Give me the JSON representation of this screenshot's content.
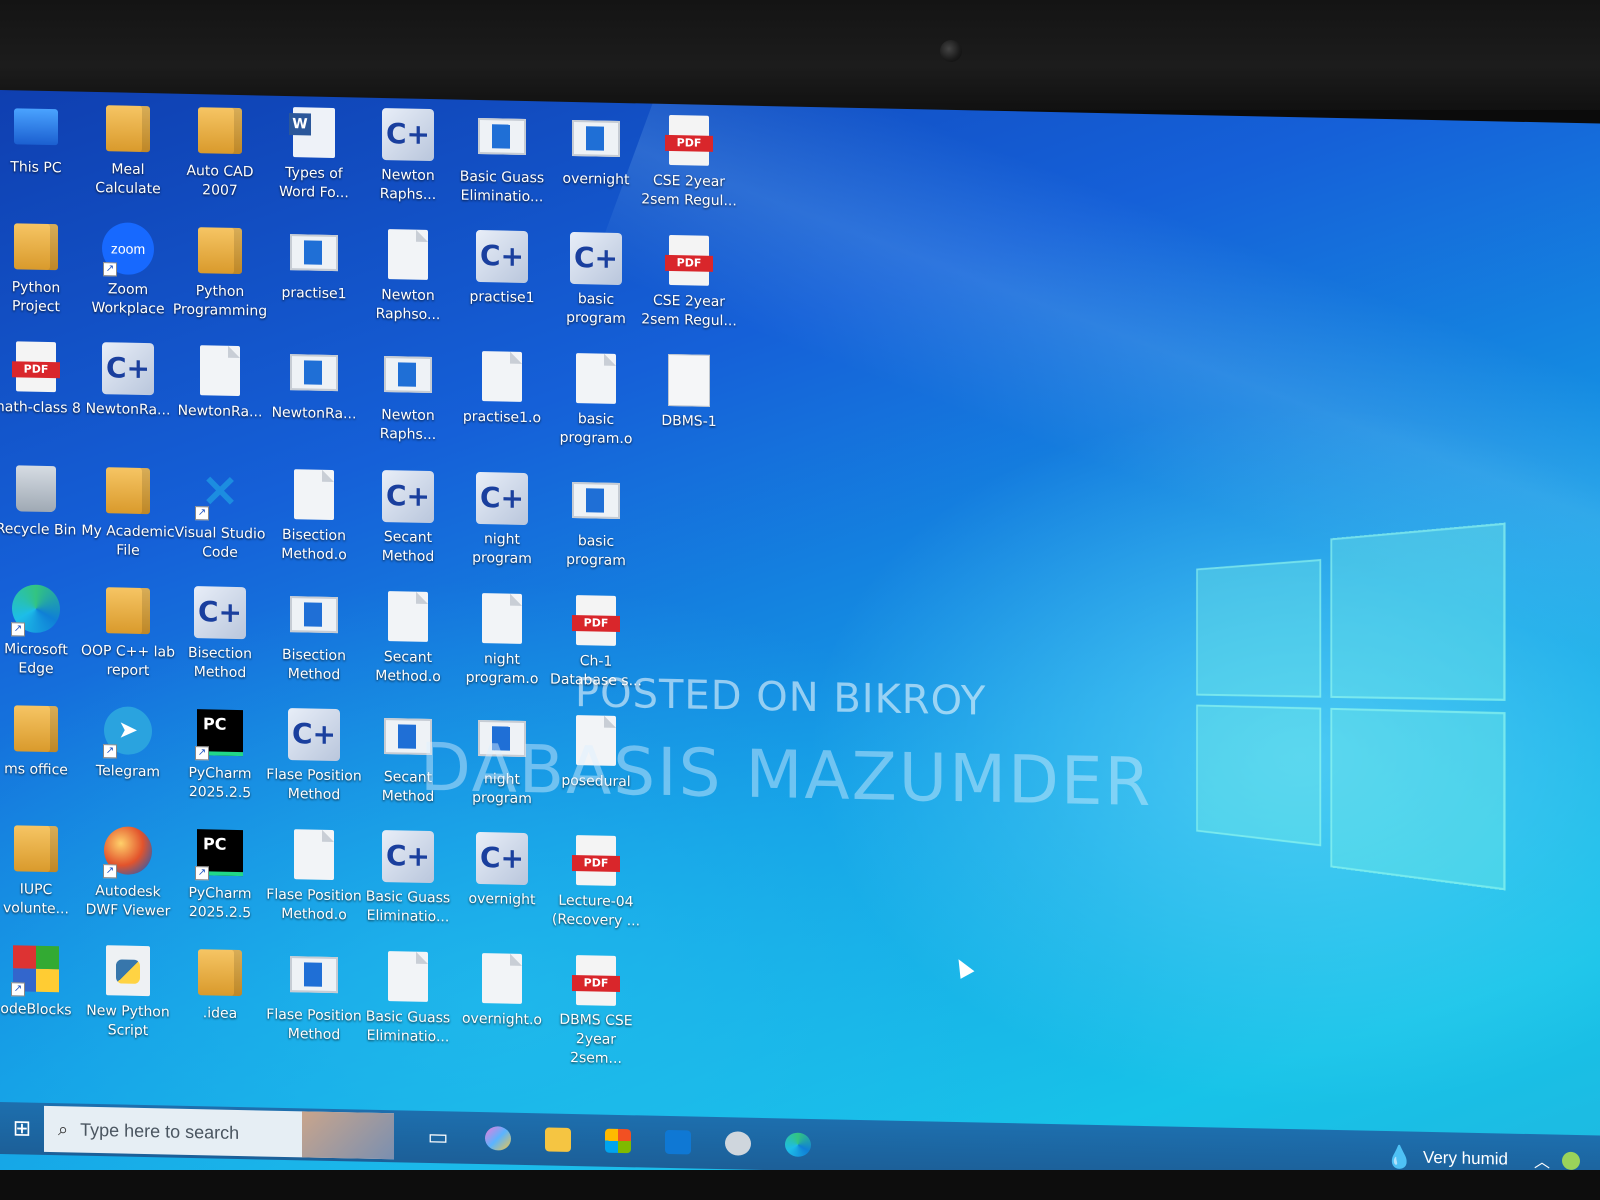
{
  "watermark": {
    "line1": "POSTED ON BIKROY",
    "line2": "DABASIS MAZUMDER"
  },
  "desktop_icons": [
    {
      "label": "This PC",
      "icon": "pc-icon"
    },
    {
      "label": "Meal Calculate",
      "icon": "folder-icon"
    },
    {
      "label": "Auto CAD 2007",
      "icon": "folder-icon"
    },
    {
      "label": "Types of Word Fo...",
      "icon": "word-doc-icon"
    },
    {
      "label": "Newton Raphs...",
      "icon": "cpp-file-icon"
    },
    {
      "label": "Basic Guass Eliminatio...",
      "icon": "exe-icon"
    },
    {
      "label": "overnight",
      "icon": "exe-icon"
    },
    {
      "label": "CSE 2year 2sem Regul...",
      "icon": "pdf-icon"
    },
    {
      "label": "Python Project",
      "icon": "folder-icon"
    },
    {
      "label": "Zoom Workplace",
      "icon": "zoom-icon"
    },
    {
      "label": "Python Programming",
      "icon": "folder-icon"
    },
    {
      "label": "practise1",
      "icon": "exe-icon"
    },
    {
      "label": "Newton Raphso...",
      "icon": "file-icon"
    },
    {
      "label": "practise1",
      "icon": "cpp-file-icon"
    },
    {
      "label": "basic program",
      "icon": "cpp-file-icon"
    },
    {
      "label": "CSE 2year 2sem Regul...",
      "icon": "pdf-icon"
    },
    {
      "label": "math-class 8",
      "icon": "pdf-icon"
    },
    {
      "label": "NewtonRa...",
      "icon": "cpp-file-icon"
    },
    {
      "label": "NewtonRa...",
      "icon": "file-icon"
    },
    {
      "label": "NewtonRa...",
      "icon": "exe-icon"
    },
    {
      "label": "Newton Raphs...",
      "icon": "exe-icon"
    },
    {
      "label": "practise1.o",
      "icon": "file-icon"
    },
    {
      "label": "basic program.o",
      "icon": "file-icon"
    },
    {
      "label": "DBMS-1",
      "icon": "dbms-doc-icon"
    },
    {
      "label": "Recycle Bin",
      "icon": "recycle-bin-icon"
    },
    {
      "label": "My Academic File",
      "icon": "folder-icon"
    },
    {
      "label": "Visual Studio Code",
      "icon": "vscode-icon"
    },
    {
      "label": "Bisection Method.o",
      "icon": "file-icon"
    },
    {
      "label": "Secant Method",
      "icon": "cpp-file-icon"
    },
    {
      "label": "night program",
      "icon": "cpp-file-icon"
    },
    {
      "label": "basic program",
      "icon": "exe-icon"
    },
    {
      "label": "Microsoft Edge",
      "icon": "edge-icon"
    },
    {
      "label": "OOP C++ lab report",
      "icon": "folder-icon"
    },
    {
      "label": "Bisection Method",
      "icon": "cpp-file-icon"
    },
    {
      "label": "Bisection Method",
      "icon": "exe-icon"
    },
    {
      "label": "Secant Method.o",
      "icon": "file-icon"
    },
    {
      "label": "night program.o",
      "icon": "file-icon"
    },
    {
      "label": "Ch-1 Database s...",
      "icon": "pdf-icon"
    },
    {
      "label": "ms office",
      "icon": "folder-icon"
    },
    {
      "label": "Telegram",
      "icon": "telegram-icon"
    },
    {
      "label": "PyCharm 2025.2.5",
      "icon": "pycharm-icon"
    },
    {
      "label": "Flase Position Method",
      "icon": "cpp-file-icon"
    },
    {
      "label": "Secant Method",
      "icon": "exe-icon"
    },
    {
      "label": "night program",
      "icon": "exe-icon"
    },
    {
      "label": "posedural",
      "icon": "file-icon"
    },
    {
      "label": "IUPC volunte...",
      "icon": "folder-icon"
    },
    {
      "label": "Autodesk DWF Viewer",
      "icon": "globe-icon"
    },
    {
      "label": "PyCharm 2025.2.5",
      "icon": "pycharm-icon"
    },
    {
      "label": "Flase Position Method.o",
      "icon": "file-icon"
    },
    {
      "label": "Basic Guass Eliminatio...",
      "icon": "cpp-file-icon"
    },
    {
      "label": "overnight",
      "icon": "cpp-file-icon"
    },
    {
      "label": "Lecture-04 (Recovery ...",
      "icon": "pdf-icon"
    },
    {
      "label": "odeBlocks",
      "icon": "codeblocks-icon"
    },
    {
      "label": "New Python Script",
      "icon": "python-file-icon"
    },
    {
      "label": ".idea",
      "icon": "folder-icon"
    },
    {
      "label": "Flase Position Method",
      "icon": "exe-icon"
    },
    {
      "label": "Basic Guass Eliminatio...",
      "icon": "file-icon"
    },
    {
      "label": "overnight.o",
      "icon": "file-icon"
    },
    {
      "label": "DBMS CSE 2year 2sem...",
      "icon": "pdf-icon"
    }
  ],
  "taskbar": {
    "search_placeholder": "Type here to search",
    "weather": "Very humid",
    "pinned": [
      "task-view-icon",
      "copilot-icon",
      "file-explorer-icon",
      "store-icon",
      "outlook-icon",
      "cloud-app-icon",
      "edge-icon"
    ]
  }
}
